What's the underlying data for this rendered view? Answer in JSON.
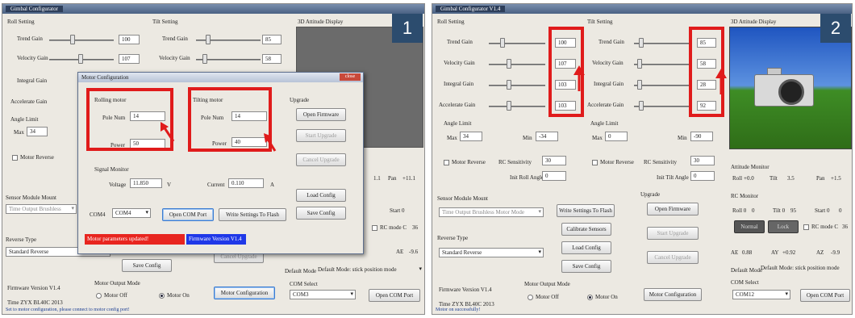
{
  "panel1": {
    "badge": "1",
    "title": "Gimbal Configurator",
    "roll_setting": "Roll Setting",
    "tilt_setting": "Tilt Setting",
    "attitude_display": "3D Attitude Display",
    "roll_trend_label": "Trend Gain",
    "roll_trend_val": "100",
    "roll_velocity_label": "Velocity Gain",
    "roll_velocity_val": "107",
    "roll_integral_label": "Integral Gain",
    "roll_accel_label": "Accelerate Gain",
    "tilt_trend_label": "Trend Gain",
    "tilt_trend_val": "85",
    "tilt_velocity_label": "Velocity Gain",
    "tilt_velocity_val": "58",
    "angle_limit": "Angle Limit",
    "max_label": "Max",
    "max_val": "34",
    "motor_reverse": "Motor Reverse",
    "sensor_module_mount": "Sensor Module Mount",
    "sensor_select": "Time Output Brushless",
    "reverse_type": "Reverse Type",
    "reverse_select": "Standard Reverse",
    "save_config": "Save Config",
    "firmware_version": "Firmware Version V1.4",
    "time": "Time ZYX BL40C 2013",
    "motor_output_mode": "Motor Output Mode",
    "motor_off": "Motor Off",
    "motor_on": "Motor On",
    "motor_config_btn": "Motor Configuration",
    "pan_label": "Pan",
    "pan_val": "+11.1",
    "roll_axis_val": "1.1",
    "start_label": "Start 0",
    "start_val": "0",
    "rc_mode": "RC mode C",
    "rc_mode_val": "36",
    "ae_label": "AE",
    "ae_val": "-9.6",
    "default_mode": "Default Mode",
    "default_mode_select": "Default Mode: stick position mode",
    "com_select_label": "COM Select",
    "com_select": "COM3",
    "open_com": "Open COM Port",
    "status": "Set to motor configuration, please connect to motor config port!",
    "dialog": {
      "title": "Motor Configuration",
      "rolling_motor": "Rolling motor",
      "tilting_motor": "Tilting motor",
      "pole_num_label": "Pole Num",
      "roll_pole_num": "14",
      "roll_power_label": "Power",
      "roll_power": "50",
      "tilt_pole_num": "14",
      "tilt_power_label": "Power",
      "tilt_power": "40",
      "upgrade": "Upgrade",
      "open_firmware": "Open Firmware",
      "start_upgrade": "Start Upgrade",
      "cancel_upgrade": "Cancel Upgrade",
      "signal_monitor": "Signal Monitor",
      "voltage_label": "Voltage",
      "voltage_val": "11.850",
      "voltage_unit": "V",
      "current_label": "Current",
      "current_val": "0.110",
      "current_unit": "A",
      "load_config": "Load Config",
      "save_config": "Save Config",
      "com_label": "COM4",
      "com_select": "COM4",
      "open_com": "Open COM Port",
      "write_flash": "Write Settings To Flash",
      "status_red": "Motor parameters updated!",
      "firmware": "Firmware Version V1.4",
      "close": "close"
    }
  },
  "panel2": {
    "badge": "2",
    "title": "Gimbal Configurator V1.4",
    "roll_setting": "Roll Setting",
    "tilt_setting": "Tilt Setting",
    "attitude_display": "3D Attitude Display",
    "trend_label": "Trend Gain",
    "velocity_label": "Velocity Gain",
    "integral_label": "Integral Gain",
    "accel_label": "Accelerate Gain",
    "roll_vals": [
      "100",
      "107",
      "103",
      "103"
    ],
    "tilt_vals": [
      "85",
      "58",
      "28",
      "92"
    ],
    "roll_angle_limit": "Angle Limit",
    "roll_max_label": "Max",
    "roll_max": "34",
    "roll_min_label": "Min",
    "roll_min": "-34",
    "tilt_angle_limit": "Angle Limit",
    "tilt_max_label": "Max",
    "tilt_max": "0",
    "tilt_min_label": "Min",
    "tilt_min": "-90",
    "motor_reverse": "Motor Reverse",
    "rc_sensitivity_label": "RC Sensitivity",
    "roll_rc_sens": "30",
    "tilt_rc_sens": "30",
    "init_roll_label": "Init Roll Angle",
    "init_roll": "0",
    "init_tilt_label": "Init Tilt Angle",
    "init_tilt": "0",
    "sensor_module_mount": "Sensor Module Mount",
    "sensor_select": "Time Output Brushless Motor Mode",
    "write_flash": "Write Settings To Flash",
    "calibrate": "Calibrate Sensors",
    "load_config": "Load Config",
    "save_config": "Save Config",
    "reverse_type": "Reverse Type",
    "reverse_select": "Standard Reverse",
    "upgrade": "Upgrade",
    "open_firmware": "Open Firmware",
    "start_upgrade": "Start Upgrade",
    "cancel_upgrade": "Cancel Upgrade",
    "attitude_monitor": "Attitude Monitor",
    "roll_label": "Roll",
    "roll_val": "+0.0",
    "tilt_label": "Tilt",
    "tilt_val": "3.5",
    "pan_label": "Pan",
    "pan_val": "+1.5",
    "rc_monitor": "RC Monitor",
    "rc_roll": "Roll 0",
    "rc_roll_val": "0",
    "rc_tilt": "Tilt 0",
    "rc_tilt_val": "95",
    "rc_start": "Start 0",
    "rc_start_val": "0",
    "mode_btn": "Normal",
    "mode_btn2": "Lock",
    "rc_mode_label": "RC mode C",
    "rc_mode_val": "36",
    "ae_label": "AE",
    "ae_val": "0.88",
    "ay_label": "AY",
    "ay_val": "+0.92",
    "az_label": "AZ",
    "az_val": "-9.9",
    "default_mode": "Default Mode",
    "default_mode_select": "Default Mode: stick position mode",
    "com_select_label": "COM Select",
    "com_select": "COM12",
    "open_com": "Open COM Port",
    "firmware_version": "Firmware Version V1.4",
    "time": "Time ZYX BL40C 2013",
    "motor_output_mode": "Motor Output Mode",
    "motor_off": "Motor Off",
    "motor_on": "Motor On",
    "motor_config_btn": "Motor Configuration",
    "status": "Motor on successfully!"
  },
  "colors": {
    "highlight_red": "#e01b1b",
    "badge_bg": "#2c4c6e",
    "status_red": "#e8251f",
    "status_blue": "#1f38e8"
  }
}
